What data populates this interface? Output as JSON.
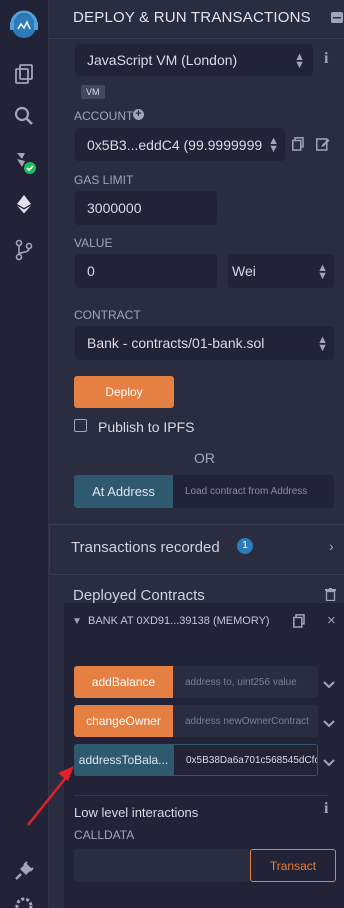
{
  "sidebar": {
    "icons": [
      "remix-logo-icon",
      "file-explorer-icon",
      "search-icon",
      "solidity-compiler-icon",
      "deploy-run-icon",
      "git-branch-icon",
      "plugin-manager-icon",
      "settings-icon"
    ]
  },
  "panel": {
    "title": "DEPLOY & RUN TRANSACTIONS",
    "environment": {
      "value": "JavaScript VM (London)",
      "badge": "VM"
    },
    "account": {
      "label": "ACCOUNT",
      "value": "0x5B3...eddC4 (99.9999999"
    },
    "gas_limit": {
      "label": "GAS LIMIT",
      "value": "3000000"
    },
    "value": {
      "label": "VALUE",
      "amount": "0",
      "unit": "Wei"
    },
    "contract": {
      "label": "CONTRACT",
      "value": "Bank - contracts/01-bank.sol"
    },
    "deploy_label": "Deploy",
    "publish_ipfs_label": "Publish to IPFS",
    "or_label": "OR",
    "at_address": {
      "button": "At Address",
      "placeholder": "Load contract from Address"
    },
    "transactions_recorded": {
      "label": "Transactions recorded",
      "count": "1"
    },
    "deployed_contracts": {
      "label": "Deployed Contracts",
      "instance_title": "BANK AT 0XD91...39138 (MEMORY)",
      "functions": [
        {
          "name": "addBalance",
          "placeholder": "address to, uint256 value"
        },
        {
          "name": "changeOwner",
          "placeholder": "address newOwnerContract"
        },
        {
          "name": "addressToBala...",
          "value": "0x5B38Da6a701c568545dCfc"
        }
      ],
      "low_level_label": "Low level interactions",
      "calldata_label": "CALLDATA",
      "transact_label": "Transact"
    }
  },
  "colors": {
    "accent": "#e57f42",
    "teal": "#2f596f",
    "sidebar_bg": "#222336",
    "panel_bg": "#2a2c3f",
    "badge_blue": "#2a7bb8",
    "green_check": "#1bbf5c"
  }
}
